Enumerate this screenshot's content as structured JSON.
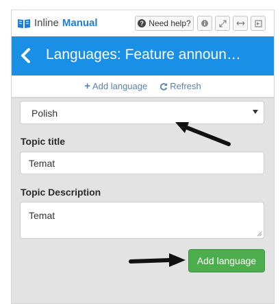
{
  "brand": {
    "part1": "Inline",
    "part2": "Manual"
  },
  "toolbar": {
    "help_label": "Need help?",
    "help_icon": "?"
  },
  "header": {
    "title": "Languages: Feature announ…"
  },
  "actions": {
    "add_language": "Add language",
    "refresh": "Refresh"
  },
  "form": {
    "language_selected": "Polish",
    "topic_title_label": "Topic title",
    "topic_title_value": "Temat",
    "topic_description_label": "Topic Description",
    "topic_description_value": "Temat",
    "submit_label": "Add language"
  },
  "colors": {
    "header_bg": "#1a8fe6",
    "brand_accent": "#1e7fd6",
    "submit_bg": "#4cae4c"
  }
}
